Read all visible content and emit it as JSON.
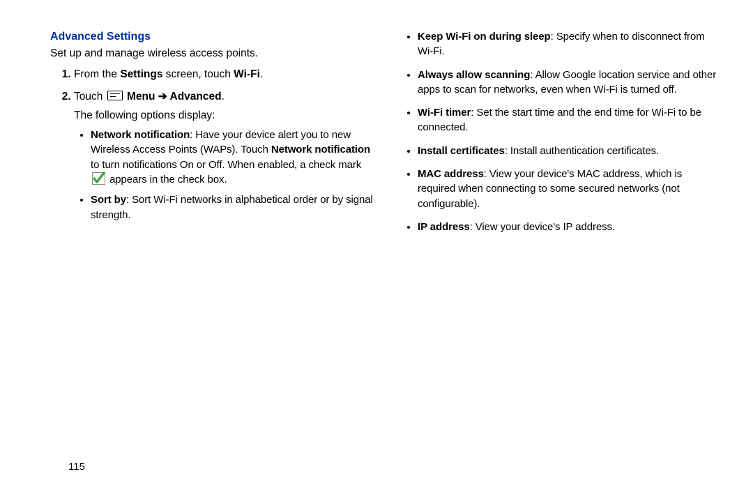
{
  "heading": "Advanced Settings",
  "intro": "Set up and manage wireless access points.",
  "step1_pre": "From the ",
  "step1_b1": "Settings",
  "step1_mid": " screen, touch ",
  "step1_b2": "Wi-Fi",
  "step1_post": ".",
  "step2_pre": "Touch ",
  "step2_menu": " Menu ",
  "step2_arrow": "➔",
  "step2_adv": " Advanced",
  "step2_post": ".",
  "step2_follow": "The following options display:",
  "nn_label": "Network notification",
  "nn_text1": ": Have your device alert you to new Wireless Access Points (WAPs). Touch ",
  "nn_b2": "Network notification",
  "nn_text2": " to turn notifications On or Off. When enabled, a check mark ",
  "nn_text3": " appears in the check box.",
  "sort_label": "Sort by",
  "sort_text": ": Sort Wi-Fi networks in alphabetical order or by signal strength.",
  "r1_label": "Keep Wi-Fi on during sleep",
  "r1_text": ": Specify when to disconnect from Wi-Fi.",
  "r2_label": "Always allow scanning",
  "r2_text": ": Allow Google location service and other apps to scan for networks, even when Wi-Fi is turned off.",
  "r3_label": "Wi-Fi timer",
  "r3_text": ": Set the start time and the end time for Wi-Fi to be connected.",
  "r4_label": "Install certificates",
  "r4_text": ": Install authentication certificates.",
  "r5_label": "MAC address",
  "r5_text": ": View your device's MAC address, which is required when connecting to some secured networks (not configurable).",
  "r6_label": "IP address",
  "r6_text": ": View your device's IP address.",
  "pagenum": "115"
}
